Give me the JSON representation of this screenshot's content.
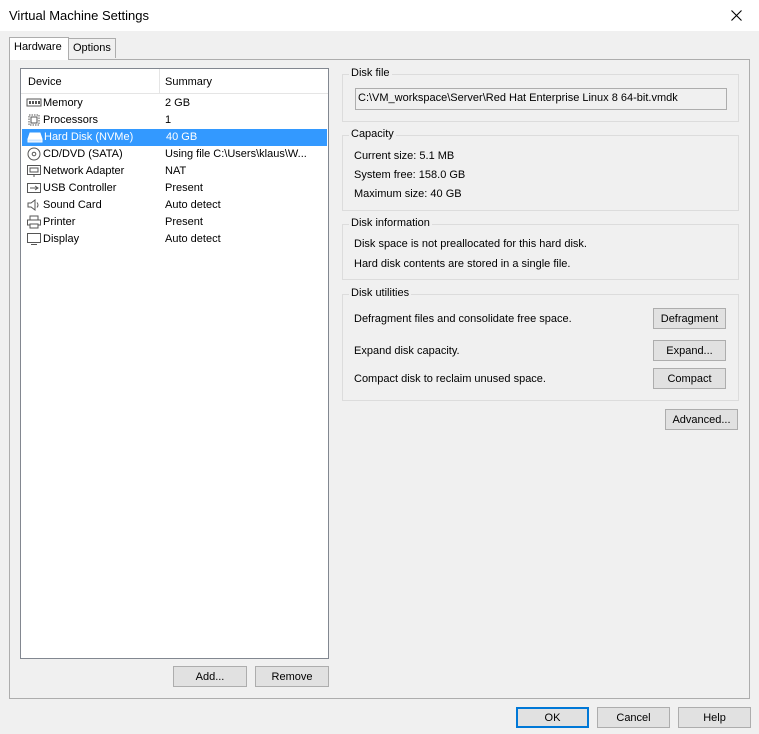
{
  "window": {
    "title": "Virtual Machine Settings"
  },
  "tabs": [
    {
      "label": "Hardware"
    },
    {
      "label": "Options"
    }
  ],
  "device_list": {
    "columns": {
      "device": "Device",
      "summary": "Summary"
    },
    "rows": [
      {
        "device": "Memory",
        "summary": "2 GB",
        "icon": "memory-icon"
      },
      {
        "device": "Processors",
        "summary": "1",
        "icon": "processor-icon"
      },
      {
        "device": "Hard Disk (NVMe)",
        "summary": "40 GB",
        "icon": "hard-disk-icon"
      },
      {
        "device": "CD/DVD (SATA)",
        "summary": "Using file C:\\Users\\klaus\\W...",
        "icon": "cd-dvd-icon"
      },
      {
        "device": "Network Adapter",
        "summary": "NAT",
        "icon": "network-adapter-icon"
      },
      {
        "device": "USB Controller",
        "summary": "Present",
        "icon": "usb-icon"
      },
      {
        "device": "Sound Card",
        "summary": "Auto detect",
        "icon": "speaker-icon"
      },
      {
        "device": "Printer",
        "summary": "Present",
        "icon": "printer-icon"
      },
      {
        "device": "Display",
        "summary": "Auto detect",
        "icon": "display-icon"
      }
    ],
    "selected": "Hard Disk (NVMe)",
    "add_label": "Add...",
    "remove_label": "Remove"
  },
  "disk_file": {
    "title": "Disk file",
    "path": "C:\\VM_workspace\\Server\\Red Hat Enterprise Linux 8 64-bit.vmdk"
  },
  "capacity": {
    "title": "Capacity",
    "current": "Current size:  5.1 MB",
    "free": "System free:  158.0 GB",
    "max": "Maximum size:  40 GB"
  },
  "disk_info": {
    "title": "Disk information",
    "line1": "Disk space is not preallocated for this hard disk.",
    "line2": "Hard disk contents are stored in a single file."
  },
  "disk_utilities": {
    "title": "Disk utilities",
    "defrag_text": "Defragment files and consolidate free space.",
    "defrag_label": "Defragment",
    "expand_text": "Expand disk capacity.",
    "expand_label": "Expand...",
    "compact_text": "Compact disk to reclaim unused space.",
    "compact_label": "Compact"
  },
  "advanced_label": "Advanced...",
  "footer": {
    "ok": "OK",
    "cancel": "Cancel",
    "help": "Help"
  }
}
